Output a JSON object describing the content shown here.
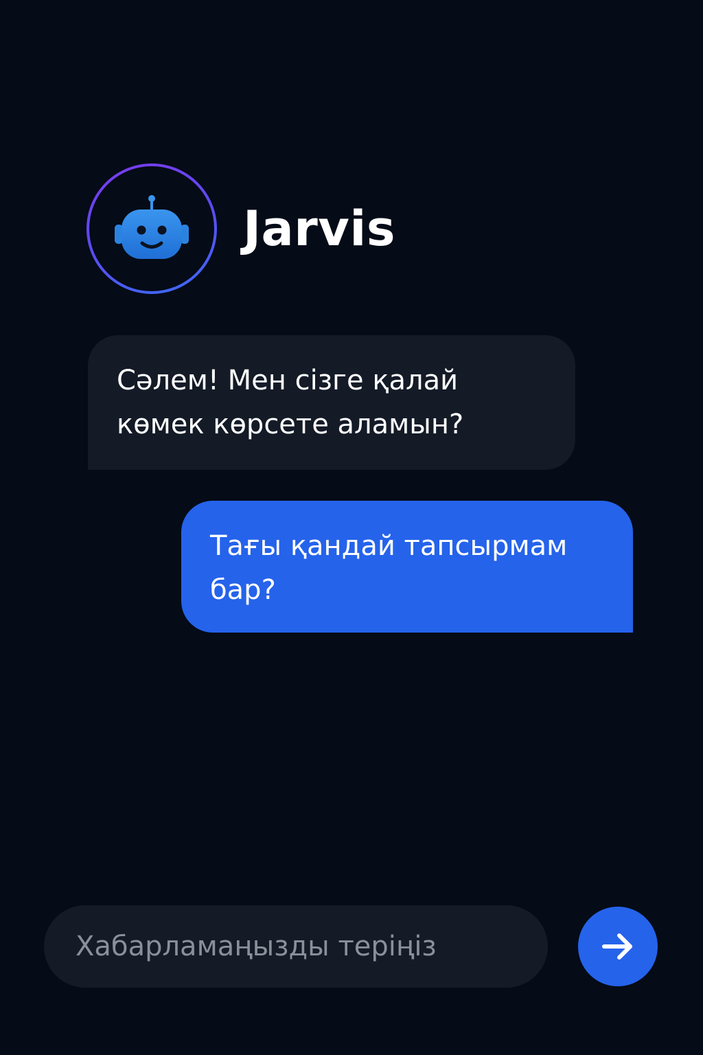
{
  "header": {
    "bot_name": "Jarvis",
    "avatar_icon": "robot-face-icon"
  },
  "messages": [
    {
      "sender": "bot",
      "text": "Сәлем! Мен сізге қалай көмек көрсете аламын?"
    },
    {
      "sender": "user",
      "text": "Тағы қандай тапсырмам бар?"
    }
  ],
  "composer": {
    "value": "",
    "placeholder": "Хабарламаңызды теріңіз",
    "send_icon": "arrow-right-icon"
  },
  "colors": {
    "background": "#050b17",
    "bot_bubble": "#141b27",
    "user_bubble": "#2563eb",
    "accent": "#2563eb",
    "avatar_ring_start": "#7c3aed",
    "avatar_ring_end": "#3b6cf5",
    "robot_face": "#2b83e0"
  }
}
